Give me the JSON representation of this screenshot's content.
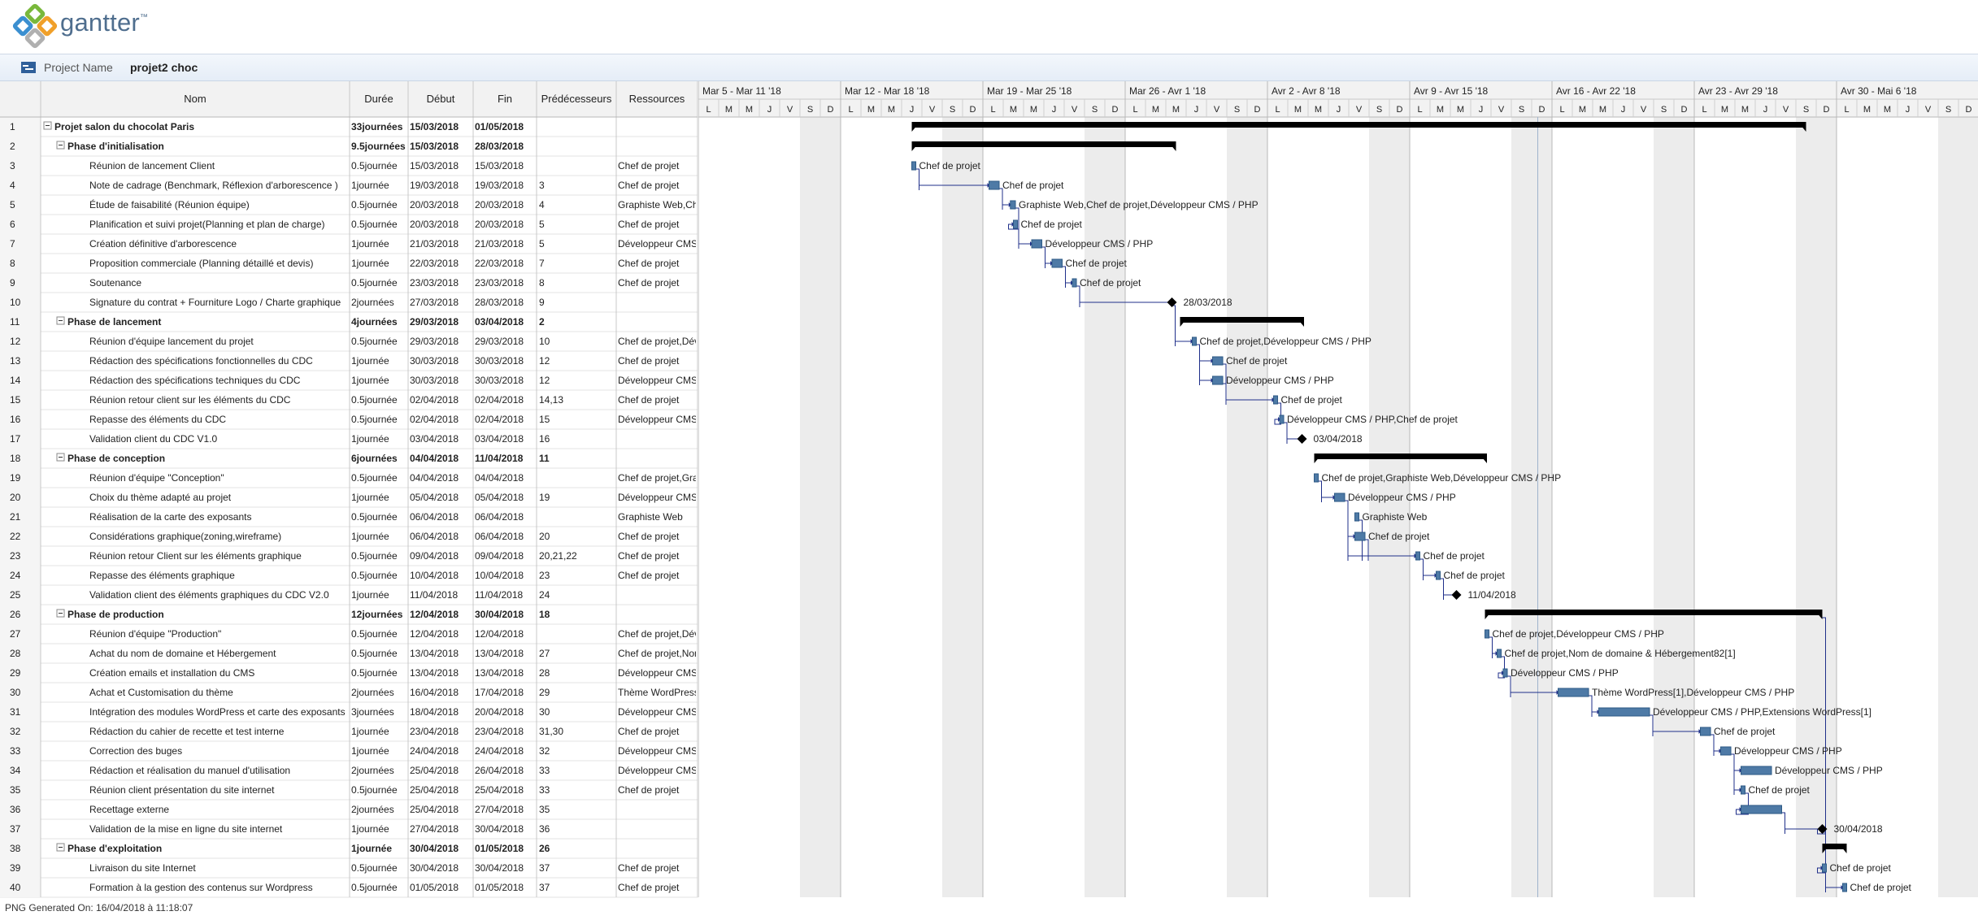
{
  "app": {
    "logo_text": "gantter",
    "trademark": "™"
  },
  "project": {
    "label": "Project Name",
    "name": "projet2 choc"
  },
  "columns": {
    "name": "Nom",
    "duration": "Durée",
    "start": "Début",
    "end": "Fin",
    "predecessors": "Prédécesseurs",
    "resources": "Ressources"
  },
  "weeks": [
    "Mar 5 - Mar 11 '18",
    "Mar 12 - Mar 18 '18",
    "Mar 19 - Mar 25 '18",
    "Mar 26 - Avr 1 '18",
    "Avr 2 - Avr 8 '18",
    "Avr 9 - Avr 15 '18",
    "Avr 16 - Avr 22 '18",
    "Avr 23 - Avr 29 '18",
    "Avr 30 - Mai 6 '18"
  ],
  "day_letters": [
    "L",
    "M",
    "M",
    "J",
    "V",
    "S",
    "D"
  ],
  "tasks": [
    {
      "id": "1",
      "name": "Projet salon du chocolat Paris",
      "duration": "33journées",
      "start": "15/03/2018",
      "end": "01/05/2018",
      "pred": "",
      "res": "",
      "level": 0,
      "summary": true
    },
    {
      "id": "2",
      "name": "Phase d'initialisation",
      "duration": "9.5journées",
      "start": "15/03/2018",
      "end": "28/03/2018",
      "pred": "",
      "res": "",
      "level": 1,
      "summary": true
    },
    {
      "id": "3",
      "name": "Réunion de lancement Client",
      "duration": "0.5journée",
      "start": "15/03/2018",
      "end": "15/03/2018",
      "pred": "",
      "res": "Chef de projet",
      "level": 2,
      "summary": false
    },
    {
      "id": "4",
      "name": "Note de cadrage (Benchmark, Réflexion d'arborescence )",
      "duration": "1journée",
      "start": "19/03/2018",
      "end": "19/03/2018",
      "pred": "3",
      "res": "Chef de projet",
      "level": 2,
      "summary": false
    },
    {
      "id": "5",
      "name": "Étude de faisabilité (Réunion équipe)",
      "duration": "0.5journée",
      "start": "20/03/2018",
      "end": "20/03/2018",
      "pred": "4",
      "res": "Graphiste Web,Chef de projet,Développeur CMS / PHP",
      "level": 2,
      "summary": false
    },
    {
      "id": "6",
      "name": "Planification et suivi projet(Planning et plan de charge)",
      "duration": "0.5journée",
      "start": "20/03/2018",
      "end": "20/03/2018",
      "pred": "5",
      "res": "Chef de projet",
      "level": 2,
      "summary": false
    },
    {
      "id": "7",
      "name": "Création définitive d'arborescence",
      "duration": "1journée",
      "start": "21/03/2018",
      "end": "21/03/2018",
      "pred": "5",
      "res": "Développeur CMS / PHP",
      "level": 2,
      "summary": false
    },
    {
      "id": "8",
      "name": "Proposition commerciale (Planning détaillé et devis)",
      "duration": "1journée",
      "start": "22/03/2018",
      "end": "22/03/2018",
      "pred": "7",
      "res": "Chef de projet",
      "level": 2,
      "summary": false
    },
    {
      "id": "9",
      "name": "Soutenance",
      "duration": "0.5journée",
      "start": "23/03/2018",
      "end": "23/03/2018",
      "pred": "8",
      "res": "Chef de projet",
      "level": 2,
      "summary": false
    },
    {
      "id": "10",
      "name": "Signature du contrat + Fourniture Logo / Charte graphique",
      "duration": "2journées",
      "start": "27/03/2018",
      "end": "28/03/2018",
      "pred": "9",
      "res": "",
      "level": 2,
      "summary": false
    },
    {
      "id": "11",
      "name": "Phase de lancement",
      "duration": "4journées",
      "start": "29/03/2018",
      "end": "03/04/2018",
      "pred": "2",
      "res": "",
      "level": 1,
      "summary": true
    },
    {
      "id": "12",
      "name": "Réunion d'équipe lancement du projet",
      "duration": "0.5journée",
      "start": "29/03/2018",
      "end": "29/03/2018",
      "pred": "10",
      "res": "Chef de projet,Développeur CMS / PHP",
      "level": 2,
      "summary": false
    },
    {
      "id": "13",
      "name": "Rédaction des spécifications fonctionnelles du CDC",
      "duration": "1journée",
      "start": "30/03/2018",
      "end": "30/03/2018",
      "pred": "12",
      "res": "Chef de projet",
      "level": 2,
      "summary": false
    },
    {
      "id": "14",
      "name": "Rédaction des spécifications techniques du CDC",
      "duration": "1journée",
      "start": "30/03/2018",
      "end": "30/03/2018",
      "pred": "12",
      "res": "Développeur CMS / PHP",
      "level": 2,
      "summary": false
    },
    {
      "id": "15",
      "name": "Réunion retour client sur les éléments du CDC",
      "duration": "0.5journée",
      "start": "02/04/2018",
      "end": "02/04/2018",
      "pred": "14,13",
      "res": "Chef de projet",
      "level": 2,
      "summary": false
    },
    {
      "id": "16",
      "name": "Repasse des éléments du CDC",
      "duration": "0.5journée",
      "start": "02/04/2018",
      "end": "02/04/2018",
      "pred": "15",
      "res": "Développeur CMS / PHP,Chef de projet",
      "level": 2,
      "summary": false
    },
    {
      "id": "17",
      "name": "Validation client du CDC V1.0",
      "duration": "1journée",
      "start": "03/04/2018",
      "end": "03/04/2018",
      "pred": "16",
      "res": "",
      "level": 2,
      "summary": false
    },
    {
      "id": "18",
      "name": "Phase de conception",
      "duration": "6journées",
      "start": "04/04/2018",
      "end": "11/04/2018",
      "pred": "11",
      "res": "",
      "level": 1,
      "summary": true
    },
    {
      "id": "19",
      "name": "Réunion d'équipe \"Conception\"",
      "duration": "0.5journée",
      "start": "04/04/2018",
      "end": "04/04/2018",
      "pred": "",
      "res": "Chef de projet,Graphiste Web,Développeur CMS / PHP",
      "level": 2,
      "summary": false
    },
    {
      "id": "20",
      "name": "Choix du thème adapté au projet",
      "duration": "1journée",
      "start": "05/04/2018",
      "end": "05/04/2018",
      "pred": "19",
      "res": "Développeur CMS / PHP",
      "level": 2,
      "summary": false
    },
    {
      "id": "21",
      "name": "Réalisation de la carte des exposants",
      "duration": "0.5journée",
      "start": "06/04/2018",
      "end": "06/04/2018",
      "pred": "",
      "res": "Graphiste Web",
      "level": 2,
      "summary": false
    },
    {
      "id": "22",
      "name": "Considérations graphique(zoning,wireframe)",
      "duration": "1journée",
      "start": "06/04/2018",
      "end": "06/04/2018",
      "pred": "20",
      "res": "Chef de projet",
      "level": 2,
      "summary": false
    },
    {
      "id": "23",
      "name": "Réunion retour Client sur les éléments graphique",
      "duration": "0.5journée",
      "start": "09/04/2018",
      "end": "09/04/2018",
      "pred": "20,21,22",
      "res": "Chef de projet",
      "level": 2,
      "summary": false
    },
    {
      "id": "24",
      "name": "Repasse des éléments graphique",
      "duration": "0.5journée",
      "start": "10/04/2018",
      "end": "10/04/2018",
      "pred": "23",
      "res": "Chef de projet",
      "level": 2,
      "summary": false
    },
    {
      "id": "25",
      "name": "Validation client des éléments graphiques du CDC V2.0",
      "duration": "1journée",
      "start": "11/04/2018",
      "end": "11/04/2018",
      "pred": "24",
      "res": "",
      "level": 2,
      "summary": false
    },
    {
      "id": "26",
      "name": "Phase de production",
      "duration": "12journées",
      "start": "12/04/2018",
      "end": "30/04/2018",
      "pred": "18",
      "res": "",
      "level": 1,
      "summary": true
    },
    {
      "id": "27",
      "name": "Réunion d'équipe \"Production\"",
      "duration": "0.5journée",
      "start": "12/04/2018",
      "end": "12/04/2018",
      "pred": "",
      "res": "Chef de projet,Développeur CMS / PHP",
      "level": 2,
      "summary": false
    },
    {
      "id": "28",
      "name": "Achat du nom de domaine et Hébergement",
      "duration": "0.5journée",
      "start": "13/04/2018",
      "end": "13/04/2018",
      "pred": "27",
      "res": "Chef de projet,Nom de domaine & Hébergement82[1]",
      "level": 2,
      "summary": false
    },
    {
      "id": "29",
      "name": "Création emails et installation du CMS",
      "duration": "0.5journée",
      "start": "13/04/2018",
      "end": "13/04/2018",
      "pred": "28",
      "res": "Développeur CMS / PHP",
      "level": 2,
      "summary": false
    },
    {
      "id": "30",
      "name": "Achat et Customisation du thème",
      "duration": "2journées",
      "start": "16/04/2018",
      "end": "17/04/2018",
      "pred": "29",
      "res": "Thème WordPress[1],Développeur CMS / PHP",
      "level": 2,
      "summary": false
    },
    {
      "id": "31",
      "name": "Intégration des modules WordPress et carte des exposants",
      "duration": "3journées",
      "start": "18/04/2018",
      "end": "20/04/2018",
      "pred": "30",
      "res": "Développeur CMS / PHP,Extensions WordPress[1]",
      "level": 2,
      "summary": false
    },
    {
      "id": "32",
      "name": "Rédaction du cahier de recette et test interne",
      "duration": "1journée",
      "start": "23/04/2018",
      "end": "23/04/2018",
      "pred": "31,30",
      "res": "Chef de projet",
      "level": 2,
      "summary": false
    },
    {
      "id": "33",
      "name": "Correction des buges",
      "duration": "1journée",
      "start": "24/04/2018",
      "end": "24/04/2018",
      "pred": "32",
      "res": "Développeur CMS / PHP",
      "level": 2,
      "summary": false
    },
    {
      "id": "34",
      "name": "Rédaction et réalisation du manuel d'utilisation",
      "duration": "2journées",
      "start": "25/04/2018",
      "end": "26/04/2018",
      "pred": "33",
      "res": "Développeur CMS / PHP",
      "level": 2,
      "summary": false
    },
    {
      "id": "35",
      "name": "Réunion client présentation du site internet",
      "duration": "0.5journée",
      "start": "25/04/2018",
      "end": "25/04/2018",
      "pred": "33",
      "res": "Chef de projet",
      "level": 2,
      "summary": false
    },
    {
      "id": "36",
      "name": "Recettage externe",
      "duration": "2journées",
      "start": "25/04/2018",
      "end": "27/04/2018",
      "pred": "35",
      "res": "",
      "level": 2,
      "summary": false
    },
    {
      "id": "37",
      "name": "Validation de la mise en ligne du site internet",
      "duration": "1journée",
      "start": "27/04/2018",
      "end": "30/04/2018",
      "pred": "36",
      "res": "",
      "level": 2,
      "summary": false
    },
    {
      "id": "38",
      "name": "Phase d'exploitation",
      "duration": "1journée",
      "start": "30/04/2018",
      "end": "01/05/2018",
      "pred": "26",
      "res": "",
      "level": 1,
      "summary": true
    },
    {
      "id": "39",
      "name": "Livraison du site Internet",
      "duration": "0.5journée",
      "start": "30/04/2018",
      "end": "30/04/2018",
      "pred": "37",
      "res": "Chef de projet",
      "level": 2,
      "summary": false
    },
    {
      "id": "40",
      "name": "Formation à la gestion des contenus sur Wordpress",
      "duration": "0.5journée",
      "start": "01/05/2018",
      "end": "01/05/2018",
      "pred": "37",
      "res": "Chef de projet",
      "level": 2,
      "summary": false
    }
  ],
  "bars": [
    {
      "row": 1,
      "kind": "summary",
      "start": 10.5,
      "end": 54.5
    },
    {
      "row": 2,
      "kind": "summary",
      "start": 10.5,
      "end": 23.5
    },
    {
      "row": 3,
      "kind": "task",
      "start": 10.5,
      "end": 10.7,
      "label": "Chef de projet"
    },
    {
      "row": 4,
      "kind": "task",
      "start": 14.3,
      "end": 14.8,
      "label": "Chef de projet"
    },
    {
      "row": 5,
      "kind": "task",
      "start": 15.35,
      "end": 15.6,
      "label": "Graphiste Web,Chef de projet,Développeur CMS / PHP"
    },
    {
      "row": 6,
      "kind": "task",
      "start": 15.5,
      "end": 15.7,
      "label": "Chef de projet"
    },
    {
      "row": 7,
      "kind": "task",
      "start": 16.4,
      "end": 16.9,
      "label": "Développeur CMS / PHP"
    },
    {
      "row": 8,
      "kind": "task",
      "start": 17.4,
      "end": 17.9,
      "label": "Chef de projet"
    },
    {
      "row": 9,
      "kind": "task",
      "start": 18.4,
      "end": 18.6,
      "label": "Chef de projet"
    },
    {
      "row": 10,
      "kind": "milestone",
      "start": 23.3,
      "label": "28/03/2018"
    },
    {
      "row": 11,
      "kind": "summary",
      "start": 23.7,
      "end": 29.8
    },
    {
      "row": 12,
      "kind": "task",
      "start": 24.3,
      "end": 24.5,
      "label": "Chef de projet,Développeur CMS / PHP"
    },
    {
      "row": 13,
      "kind": "task",
      "start": 25.3,
      "end": 25.8,
      "label": "Chef de projet"
    },
    {
      "row": 14,
      "kind": "task",
      "start": 25.3,
      "end": 25.8,
      "label": "Développeur CMS / PHP"
    },
    {
      "row": 15,
      "kind": "task",
      "start": 28.3,
      "end": 28.5,
      "label": "Chef de projet"
    },
    {
      "row": 16,
      "kind": "task",
      "start": 28.6,
      "end": 28.8,
      "label": "Développeur CMS / PHP,Chef de projet"
    },
    {
      "row": 17,
      "kind": "milestone",
      "start": 29.7,
      "label": "03/04/2018"
    },
    {
      "row": 18,
      "kind": "summary",
      "start": 30.3,
      "end": 38.8
    },
    {
      "row": 19,
      "kind": "task",
      "start": 30.3,
      "end": 30.5,
      "label": "Chef de projet,Graphiste Web,Développeur CMS / PHP"
    },
    {
      "row": 20,
      "kind": "task",
      "start": 31.3,
      "end": 31.8,
      "label": "Développeur CMS / PHP"
    },
    {
      "row": 21,
      "kind": "task",
      "start": 32.3,
      "end": 32.5,
      "label": "Graphiste Web"
    },
    {
      "row": 22,
      "kind": "task",
      "start": 32.3,
      "end": 32.8,
      "label": "Chef de projet"
    },
    {
      "row": 23,
      "kind": "task",
      "start": 35.3,
      "end": 35.5,
      "label": "Chef de projet"
    },
    {
      "row": 24,
      "kind": "task",
      "start": 36.3,
      "end": 36.5,
      "label": "Chef de projet"
    },
    {
      "row": 25,
      "kind": "milestone",
      "start": 37.3,
      "label": "11/04/2018"
    },
    {
      "row": 26,
      "kind": "summary",
      "start": 38.7,
      "end": 55.3
    },
    {
      "row": 27,
      "kind": "task",
      "start": 38.7,
      "end": 38.9,
      "label": "Chef de projet,Développeur CMS / PHP"
    },
    {
      "row": 28,
      "kind": "task",
      "start": 39.3,
      "end": 39.5,
      "label": "Chef de projet,Nom de domaine & Hébergement82[1]"
    },
    {
      "row": 29,
      "kind": "task",
      "start": 39.6,
      "end": 39.8,
      "label": "Développeur CMS / PHP"
    },
    {
      "row": 30,
      "kind": "task",
      "start": 42.3,
      "end": 43.8,
      "label": "Thème WordPress[1],Développeur CMS / PHP"
    },
    {
      "row": 31,
      "kind": "task",
      "start": 44.3,
      "end": 46.8,
      "label": "Développeur CMS / PHP,Extensions WordPress[1]"
    },
    {
      "row": 32,
      "kind": "task",
      "start": 49.3,
      "end": 49.8,
      "label": "Chef de projet"
    },
    {
      "row": 33,
      "kind": "task",
      "start": 50.3,
      "end": 50.8,
      "label": "Développeur CMS / PHP"
    },
    {
      "row": 34,
      "kind": "task",
      "start": 51.3,
      "end": 52.8,
      "label": "Développeur CMS / PHP"
    },
    {
      "row": 35,
      "kind": "task",
      "start": 51.3,
      "end": 51.5,
      "label": "Chef de projet"
    },
    {
      "row": 36,
      "kind": "task",
      "start": 51.3,
      "end": 53.3,
      "label": ""
    },
    {
      "row": 37,
      "kind": "milestone",
      "start": 55.3,
      "label": "30/04/2018"
    },
    {
      "row": 38,
      "kind": "summary",
      "start": 55.3,
      "end": 56.5
    },
    {
      "row": 39,
      "kind": "task",
      "start": 55.3,
      "end": 55.5,
      "label": "Chef de projet"
    },
    {
      "row": 40,
      "kind": "task",
      "start": 56.3,
      "end": 56.5,
      "label": "Chef de projet"
    }
  ],
  "links": [
    [
      3,
      4
    ],
    [
      4,
      5
    ],
    [
      5,
      6
    ],
    [
      5,
      7
    ],
    [
      7,
      8
    ],
    [
      8,
      9
    ],
    [
      9,
      10
    ],
    [
      10,
      12
    ],
    [
      12,
      13
    ],
    [
      12,
      14
    ],
    [
      14,
      15
    ],
    [
      13,
      15
    ],
    [
      15,
      16
    ],
    [
      16,
      17
    ],
    [
      19,
      20
    ],
    [
      20,
      22
    ],
    [
      21,
      23
    ],
    [
      22,
      23
    ],
    [
      20,
      23
    ],
    [
      23,
      24
    ],
    [
      24,
      25
    ],
    [
      27,
      28
    ],
    [
      28,
      29
    ],
    [
      29,
      30
    ],
    [
      30,
      31
    ],
    [
      31,
      32
    ],
    [
      32,
      33
    ],
    [
      33,
      34
    ],
    [
      33,
      35
    ],
    [
      35,
      36
    ],
    [
      36,
      37
    ],
    [
      37,
      39
    ],
    [
      37,
      40
    ],
    [
      26,
      37
    ]
  ],
  "colors": {
    "bar": "#4e7aa6",
    "summary": "#000000",
    "link": "#1f2f8a",
    "weekend": "#ececec",
    "grid": "#d0d0d0"
  },
  "footer": {
    "text": "PNG Generated On: 16/04/2018 à 11:18:07"
  }
}
